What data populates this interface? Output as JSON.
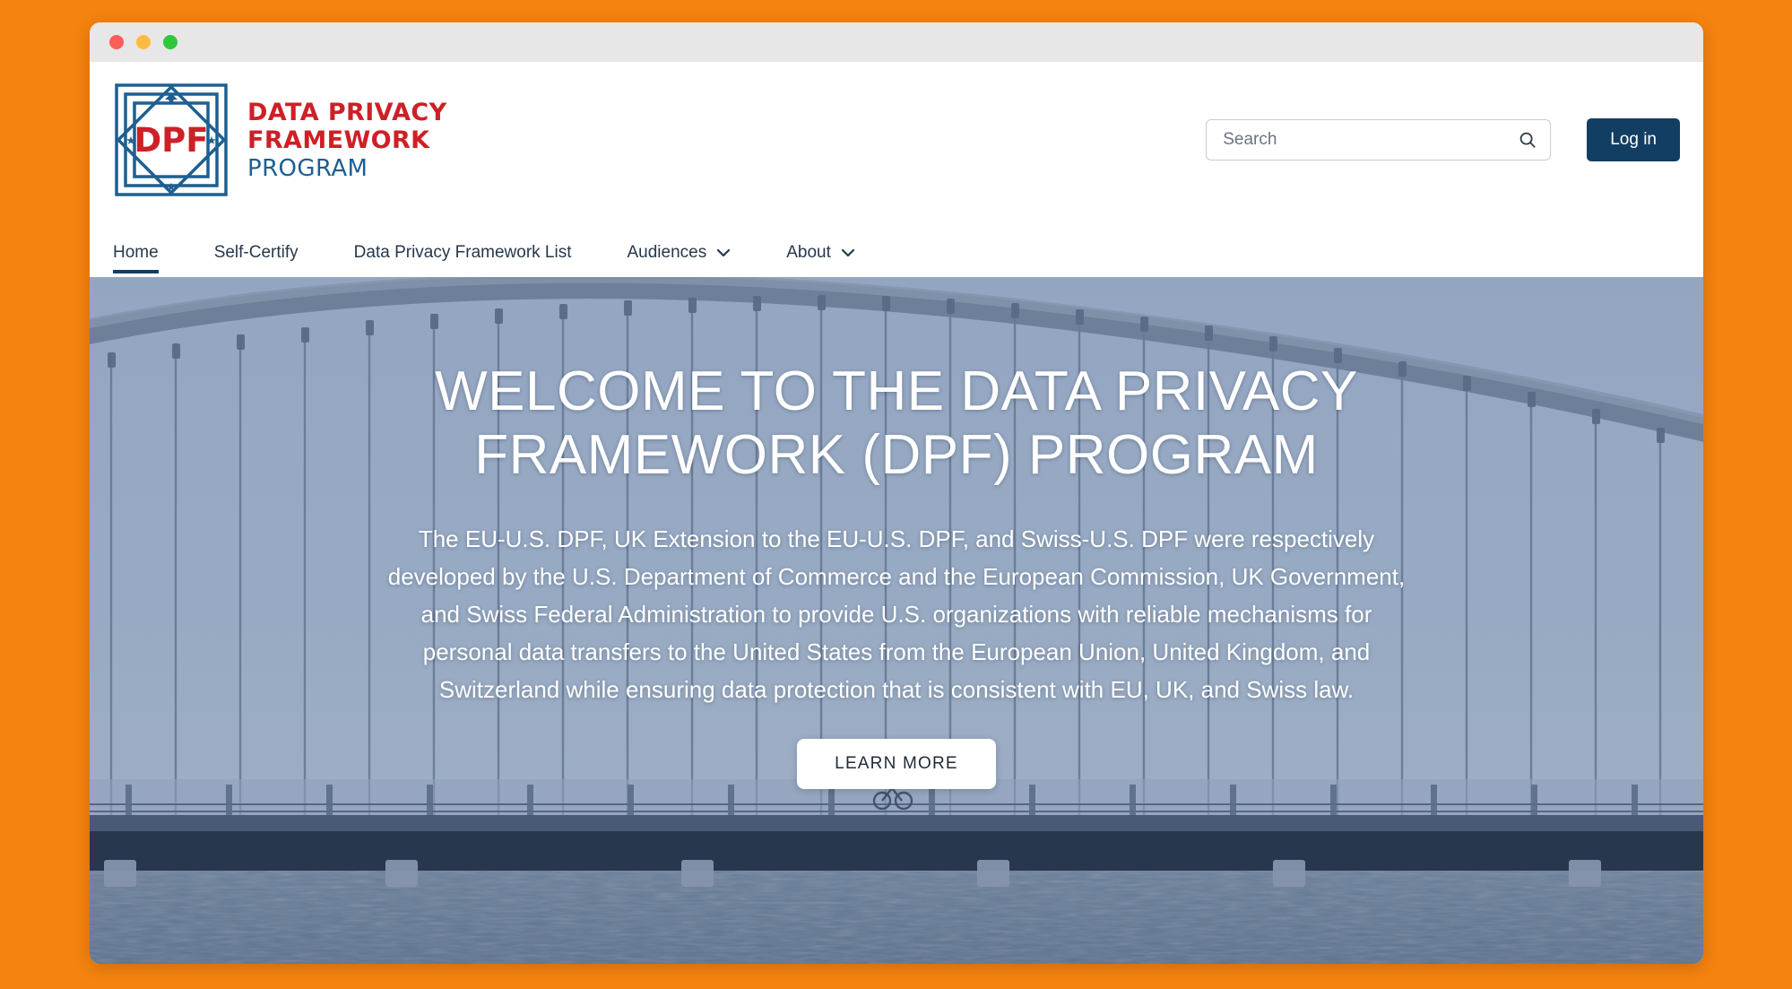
{
  "window": {
    "traffic_lights": [
      {
        "name": "close",
        "color": "#FC5E5A"
      },
      {
        "name": "minimize",
        "color": "#FDBC40"
      },
      {
        "name": "maximize",
        "color": "#2DC93B"
      }
    ]
  },
  "theme": {
    "page_background": "#F5830F",
    "brand_red": "#CE2027",
    "brand_blue": "#1D5F91",
    "navy": "#133E63"
  },
  "header": {
    "logo": {
      "mark_text": "DPF",
      "icon": "dpf-emblem-icon",
      "line1": "DATA PRIVACY",
      "line2": "FRAMEWORK",
      "line3": "PROGRAM"
    },
    "search": {
      "placeholder": "Search",
      "value": "",
      "icon": "search-icon"
    },
    "login_label": "Log in"
  },
  "nav": {
    "items": [
      {
        "label": "Home",
        "active": true,
        "has_dropdown": false
      },
      {
        "label": "Self-Certify",
        "active": false,
        "has_dropdown": false
      },
      {
        "label": "Data Privacy Framework List",
        "active": false,
        "has_dropdown": false
      },
      {
        "label": "Audiences",
        "active": false,
        "has_dropdown": true
      },
      {
        "label": "About",
        "active": false,
        "has_dropdown": true
      }
    ]
  },
  "hero": {
    "title": "WELCOME TO THE DATA PRIVACY FRAMEWORK (DPF) PROGRAM",
    "paragraph": "The EU-U.S. DPF, UK Extension to the EU-U.S. DPF, and Swiss-U.S. DPF were respectively developed by the U.S. Department of Commerce and the European Commission, UK Government, and Swiss Federal Administration to provide U.S. organizations with reliable mechanisms for personal data transfers to the United States from the European Union, United Kingdom, and Switzerland while ensuring data protection that is consistent with EU, UK, and Swiss law.",
    "cta_label": "LEARN MORE",
    "background_image": "suspension-bridge-over-water-blue-tinted"
  }
}
